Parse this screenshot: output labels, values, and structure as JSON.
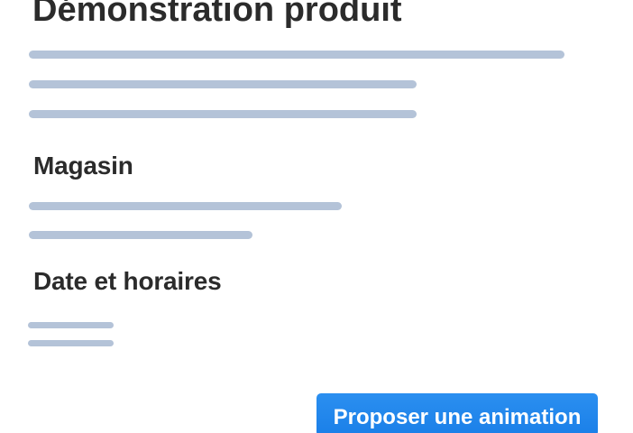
{
  "page": {
    "title": "Démonstration produit"
  },
  "sections": {
    "store": {
      "title": "Magasin"
    },
    "datetime": {
      "title": "Date et horaires"
    }
  },
  "actions": {
    "propose_label": "Proposer une animation"
  },
  "colors": {
    "skeleton": "#b4c3d8",
    "primary": "#1a7fe8",
    "text": "#2b2b2b"
  }
}
